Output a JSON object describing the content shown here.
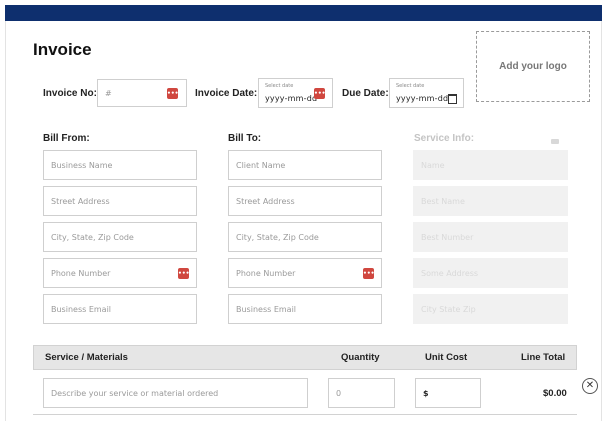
{
  "title": "Invoice",
  "logo": {
    "label": "Add your logo"
  },
  "header": {
    "invoice_no": {
      "label": "Invoice No:",
      "placeholder": "#"
    },
    "invoice_date": {
      "label": "Invoice Date:",
      "caption": "Select date",
      "value": "yyyy-mm-dd"
    },
    "due_date": {
      "label": "Due Date:",
      "caption": "Select date",
      "value": "yyyy-mm-dd"
    }
  },
  "bill_from": {
    "heading": "Bill From:",
    "fields": [
      "Business Name",
      "Street Address",
      "City, State, Zip Code",
      "Phone Number",
      "Business Email"
    ]
  },
  "bill_to": {
    "heading": "Bill To:",
    "fields": [
      "Client Name",
      "Street Address",
      "City, State, Zip Code",
      "Phone Number",
      "Business Email"
    ]
  },
  "service_info": {
    "heading": "Service Info:",
    "fields": [
      "Name",
      "Best Name",
      "Best Number",
      "Some Address",
      "City State Zip"
    ]
  },
  "table": {
    "headers": [
      "Service / Materials",
      "Quantity",
      "Unit Cost",
      "Line Total"
    ],
    "row": {
      "description_placeholder": "Describe your service or material ordered",
      "quantity_placeholder": "0",
      "currency": "$",
      "line_total": "$0.00"
    }
  },
  "icons": {
    "phone_badge": "•••",
    "remove": "✕"
  },
  "colors": {
    "topbar": "#0e2f6e",
    "badge": "#d0473f"
  }
}
